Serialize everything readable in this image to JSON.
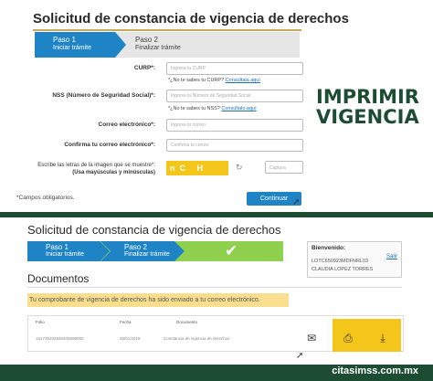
{
  "form": {
    "title": "Solicitud de constancia de vigencia de derechos",
    "steps": [
      {
        "num": "Paso 1",
        "label": "Iniciar trámite"
      },
      {
        "num": "Paso 2",
        "label": "Finalizar trámite"
      }
    ],
    "curp": {
      "label": "CURP*:",
      "placeholder": "Ingresa tu CURP",
      "hint": "*¿No te sabes tu CURP?",
      "hint_link": "Consúltala aquí"
    },
    "nss": {
      "label": "NSS (Número de Seguridad Social)*:",
      "placeholder": "Ingresa tu Número de Seguridad Social",
      "hint": "*¿No te sabes tu NSS?",
      "hint_link": "Consúltalo aquí"
    },
    "email": {
      "label": "Correo electrónico*:",
      "placeholder": "Ingresa tu correo"
    },
    "email_confirm": {
      "label": "Confirma tu correo electrónico*:",
      "placeholder": "Confirma tu correo"
    },
    "captcha": {
      "label": "Escribe las letras de la imagen que se muestre*:",
      "note": "(Usa mayúsculas y minúsculas)",
      "text": "nC H ",
      "placeholder": "Captura"
    },
    "required_note": "*Campos obligatorios.",
    "continue_label": "Continuar"
  },
  "promo": {
    "line1": "IMPRIMIR",
    "line2": "VIGENCIA"
  },
  "result": {
    "title": "Solicitud de constancia de vigencia de derechos",
    "steps": [
      {
        "num": "Paso 1",
        "label": "Iniciar trámite"
      },
      {
        "num": "Paso 2",
        "label": "Finalizar trámite"
      }
    ],
    "welcome": {
      "label": "Bienvenido:",
      "id": "LOTC650923MDFNRL03",
      "name": "CLAUDIA LOPEZ TORRES",
      "logout": "Salir"
    },
    "docs_title": "Documentos",
    "notice": "Tu comprobante de vigencia de derechos ha sido enviado a tu correo electrónico.",
    "table": {
      "headers": [
        "Folio",
        "Fecha",
        "Documento"
      ],
      "row": [
        "151735202846405698060",
        "26/01/2018",
        "Constancia de vigencia de derechos"
      ]
    }
  },
  "footer": {
    "brand": "citasimss.com.mx"
  },
  "colors": {
    "accent": "#1f84c5",
    "brand_green": "#1c4d33",
    "highlight": "#f4c51b",
    "step_done": "#8fd14f"
  }
}
